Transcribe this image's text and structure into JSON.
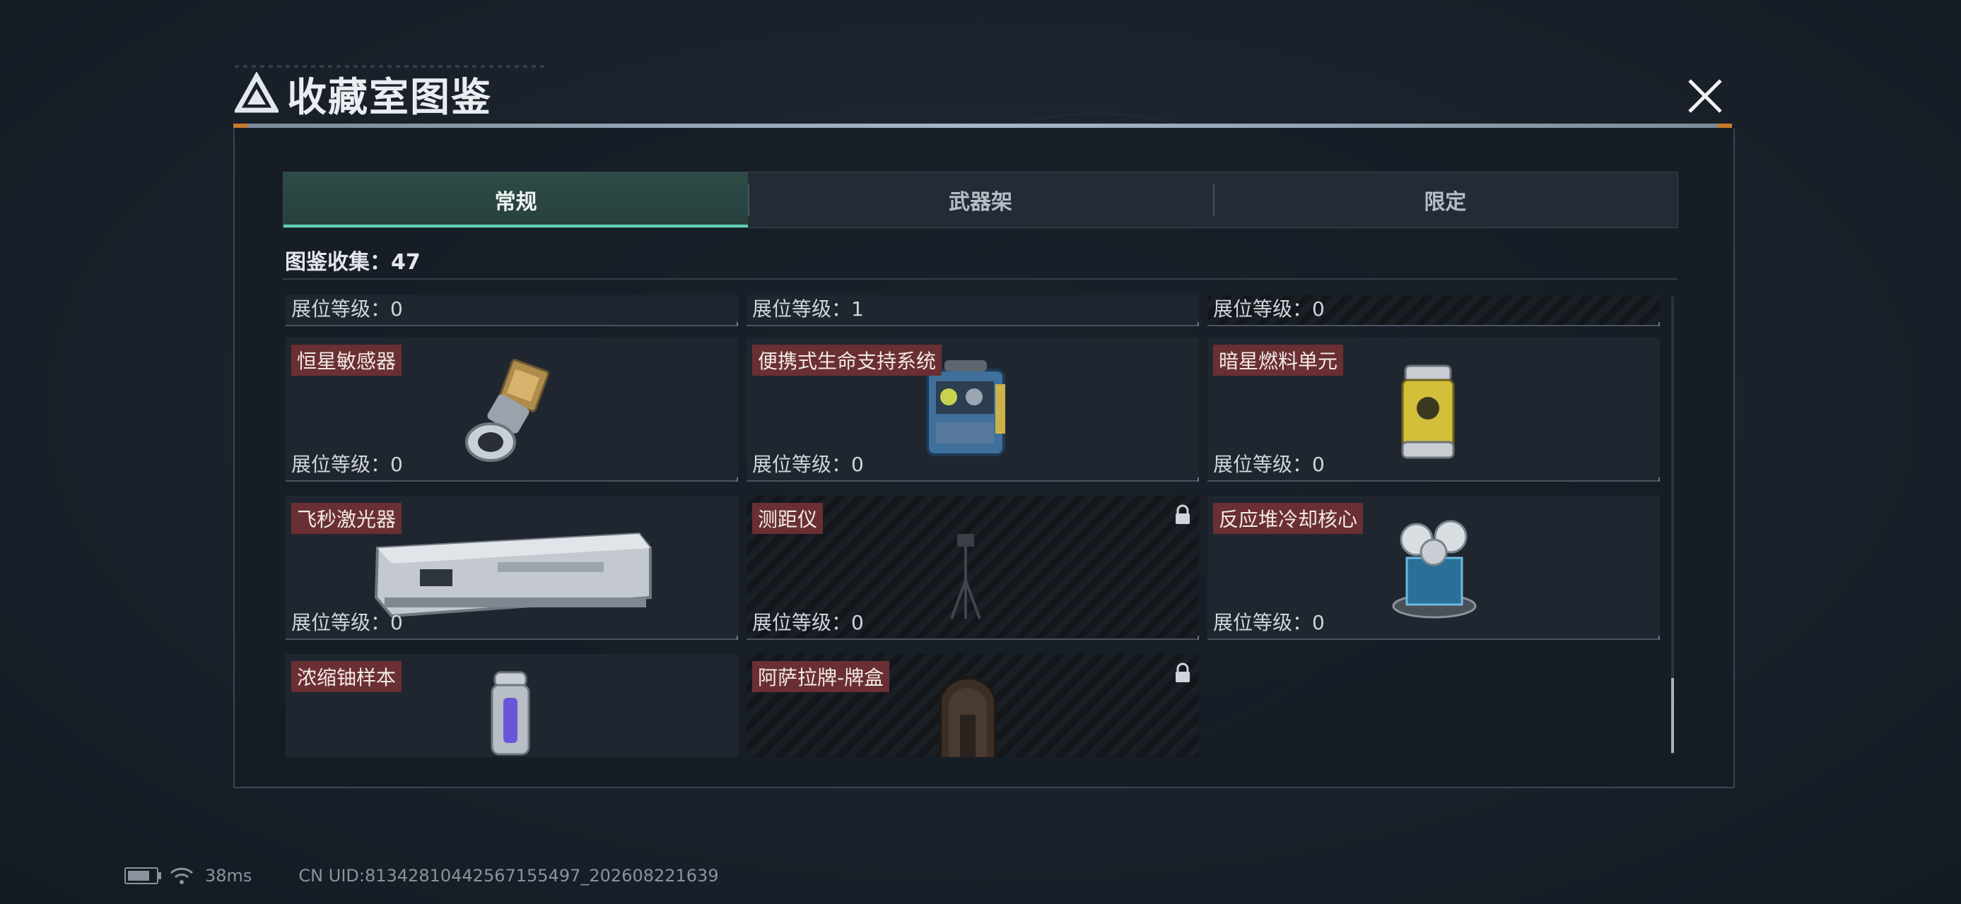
{
  "header": {
    "title": "收藏室图鉴"
  },
  "tabs": [
    {
      "label": "常规",
      "active": true
    },
    {
      "label": "武器架",
      "active": false
    },
    {
      "label": "限定",
      "active": false
    }
  ],
  "collection": {
    "label": "图鉴收集：47"
  },
  "partial_row": [
    {
      "level": "展位等级：0"
    },
    {
      "level": "展位等级：1"
    },
    {
      "level": "展位等级：0"
    }
  ],
  "items": [
    {
      "name": "恒星敏感器",
      "level": "展位等级：0",
      "locked": false,
      "icon": "star-sensor-icon"
    },
    {
      "name": "便携式生命支持系统",
      "level": "展位等级：0",
      "locked": false,
      "icon": "life-support-icon"
    },
    {
      "name": "暗星燃料单元",
      "level": "展位等级：0",
      "locked": false,
      "icon": "fuel-cell-icon"
    },
    {
      "name": "飞秒激光器",
      "level": "展位等级：0",
      "locked": false,
      "icon": "laser-icon"
    },
    {
      "name": "测距仪",
      "level": "展位等级：0",
      "locked": true,
      "icon": "rangefinder-icon"
    },
    {
      "name": "反应堆冷却核心",
      "level": "展位等级：0",
      "locked": false,
      "icon": "reactor-core-icon"
    },
    {
      "name": "浓缩铀样本",
      "level": "",
      "locked": false,
      "icon": "uranium-icon"
    },
    {
      "name": "阿萨拉牌-牌盒",
      "level": "",
      "locked": true,
      "icon": "card-box-icon"
    }
  ],
  "status_bar": {
    "ping": "38ms",
    "uid": "CN UID:8134281044256715549​7_202608221639"
  },
  "colors": {
    "accent": "#5fd1b3",
    "name_tag": "#6a2f32",
    "warning": "#c87a2a"
  }
}
